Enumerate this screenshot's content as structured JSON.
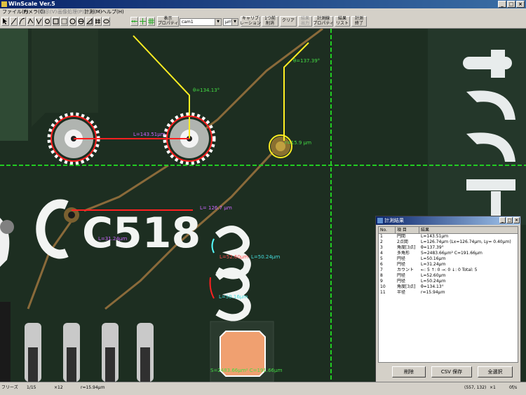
{
  "window": {
    "title": "WinScale Ver.5"
  },
  "menu": [
    {
      "label": "ファイル(F)",
      "enabled": true
    },
    {
      "label": "カメラ(C)",
      "enabled": true
    },
    {
      "label": "表示(V)",
      "enabled": false
    },
    {
      "label": "画像処理(P)",
      "enabled": false
    },
    {
      "label": "計測(M)",
      "enabled": true
    },
    {
      "label": "ヘルプ(H)",
      "enabled": true
    }
  ],
  "toolbar": {
    "display_props": "表示\nプロパティ",
    "camera_select": "cam1",
    "unit_select": "μｍ",
    "calibration": "キャリブ\nレーション",
    "undo_one": "1つ前\n削消",
    "clear": "クリア",
    "result_output": "結果\n出力",
    "measure_props": "計測線\nプロパティ",
    "result_list": "結果\nリスト",
    "measure_end": "計測\n終了"
  },
  "overlay": {
    "angle_top_left": "θ=134.13°",
    "angle_top_right": "θ=137.39°",
    "dist_horizontal": "L=143.51μｍ",
    "radius_circle": "r=15.9 μｍ",
    "dist_c518": "L= 126.7 μｍ",
    "dia_left": "L=31.24μｍ",
    "dia_3_left": "L=52.60μｍ",
    "dia_3_right": "L=50.24μｍ",
    "dia_3_lower": "L=50.16μｍ",
    "polygon": "S=2483.66μｍ²  C=191.66μｍ",
    "silkscreen": "C518"
  },
  "results": {
    "title": "計測結果",
    "headers": [
      "No.",
      "項 目",
      "結果"
    ],
    "rows": [
      {
        "no": "1",
        "item": "円間",
        "result": "L=143.51μｍ"
      },
      {
        "no": "2",
        "item": "2点間",
        "result": "L=126.74μｍ (Lx=126.74μｍ, Ly= 0.40μｍ)"
      },
      {
        "no": "3",
        "item": "角度[3点]",
        "result": "θ=137.39°"
      },
      {
        "no": "4",
        "item": "多角形",
        "result": "S=2483.66μｍ²  C=191.66μｍ"
      },
      {
        "no": "5",
        "item": "円径",
        "result": "L=50.16μｍ"
      },
      {
        "no": "6",
        "item": "円径",
        "result": "L=31.24μｍ"
      },
      {
        "no": "7",
        "item": "カウント",
        "result": "←: 5  ↑: 0  →: 0  ↓: 0  Total: 5"
      },
      {
        "no": "8",
        "item": "円径",
        "result": "L=52.60μｍ"
      },
      {
        "no": "9",
        "item": "円径",
        "result": "L=50.24μｍ"
      },
      {
        "no": "10",
        "item": "角度[3点]",
        "result": "θ=134.13°"
      },
      {
        "no": "11",
        "item": "半径",
        "result": "r=15.94μｍ"
      }
    ],
    "buttons": {
      "delete": "削除",
      "csv_save": "CSV 保存",
      "select_all": "全選択"
    }
  },
  "status": {
    "mode": "フリーズ",
    "frame": "1/15",
    "zoom_ref": "×12",
    "measure": "r=15.94μｍ",
    "coords": "(557, 132)",
    "magnification": "×1",
    "rate": "0f/s"
  },
  "colors": {
    "crosshair": "#22cc22",
    "measure_line": "#ff2020",
    "angle_line": "#ffee22",
    "label_green": "#44dd44",
    "label_purple": "#cc66ff"
  }
}
